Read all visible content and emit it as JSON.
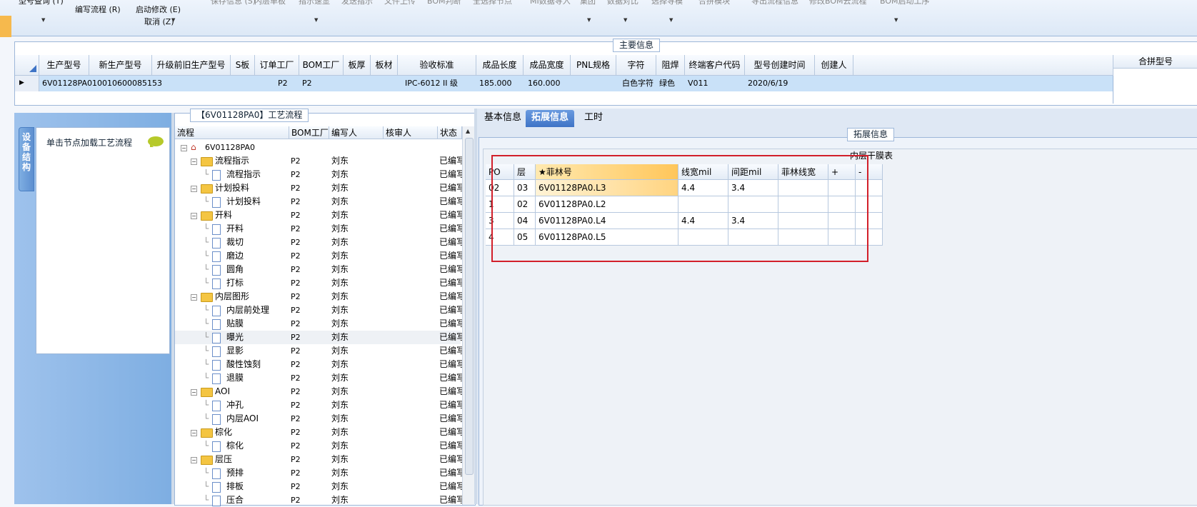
{
  "ribbon": {
    "top_row": [
      "型号查询 (T)",
      "保存信息 (S)",
      "内层单板",
      "指示速显",
      "发送指示",
      "文件上传",
      "BOM判断",
      "全选择节点",
      "MI数据导入",
      "集团",
      "数据对比",
      "选择导模",
      "合拼模块",
      "导出流程信息",
      "修改BOM云流程",
      "BOM启动工序"
    ],
    "edit_flow": "编写流程 (R)",
    "start_modify": "启动修改 (E)",
    "cancel": "取消 (Z)"
  },
  "main_info": {
    "title": "主要信息",
    "merge_header": "合拼型号",
    "columns": [
      "生产型号",
      "新生产型号",
      "升级前旧生产型号",
      "S板",
      "订单工厂",
      "BOM工厂",
      "板厚",
      "板材",
      "验收标准",
      "成品长度",
      "成品宽度",
      "PNL规格",
      "字符",
      "阻焊",
      "终端客户代码",
      "型号创建时间",
      "创建人"
    ],
    "row": [
      "6V01128PA0",
      "10010600085153",
      "",
      "",
      "P2",
      "P2",
      "",
      "",
      "IPC-6012 II 级",
      "185.000",
      "160.000",
      "",
      "白色字符",
      "绿色",
      "V011",
      "2020/6/19",
      ""
    ]
  },
  "left_panel": {
    "vertical_tab": "设备结构",
    "hint": "单击节点加载工艺流程"
  },
  "flow_tree": {
    "title": "【6V01128PA0】工艺流程",
    "columns": [
      "流程",
      "BOM工厂",
      "编写人",
      "核审人",
      "状态"
    ],
    "root": "6V01128PA0",
    "rows": [
      {
        "name": "流程指示",
        "level": 1,
        "type": "folder",
        "bom": "P2",
        "writer": "刘东",
        "status": "已编写"
      },
      {
        "name": "流程指示",
        "level": 2,
        "type": "doc",
        "bom": "P2",
        "writer": "刘东",
        "status": "已编写"
      },
      {
        "name": "计划投料",
        "level": 1,
        "type": "folder",
        "bom": "P2",
        "writer": "刘东",
        "status": "已编写"
      },
      {
        "name": "计划投料",
        "level": 2,
        "type": "doc",
        "bom": "P2",
        "writer": "刘东",
        "status": "已编写"
      },
      {
        "name": "开料",
        "level": 1,
        "type": "folder",
        "bom": "P2",
        "writer": "刘东",
        "status": "已编写"
      },
      {
        "name": "开料",
        "level": 2,
        "type": "doc",
        "bom": "P2",
        "writer": "刘东",
        "status": "已编写"
      },
      {
        "name": "裁切",
        "level": 2,
        "type": "doc",
        "bom": "P2",
        "writer": "刘东",
        "status": "已编写"
      },
      {
        "name": "磨边",
        "level": 2,
        "type": "doc",
        "bom": "P2",
        "writer": "刘东",
        "status": "已编写"
      },
      {
        "name": "圆角",
        "level": 2,
        "type": "doc",
        "bom": "P2",
        "writer": "刘东",
        "status": "已编写"
      },
      {
        "name": "打标",
        "level": 2,
        "type": "doc",
        "bom": "P2",
        "writer": "刘东",
        "status": "已编写"
      },
      {
        "name": "内层图形",
        "level": 1,
        "type": "folder",
        "bom": "P2",
        "writer": "刘东",
        "status": "已编写"
      },
      {
        "name": "内层前处理",
        "level": 2,
        "type": "doc",
        "bom": "P2",
        "writer": "刘东",
        "status": "已编写"
      },
      {
        "name": "贴膜",
        "level": 2,
        "type": "doc",
        "bom": "P2",
        "writer": "刘东",
        "status": "已编写"
      },
      {
        "name": "曝光",
        "level": 2,
        "type": "doc",
        "bom": "P2",
        "writer": "刘东",
        "status": "已编写",
        "selected": true
      },
      {
        "name": "显影",
        "level": 2,
        "type": "doc",
        "bom": "P2",
        "writer": "刘东",
        "status": "已编写"
      },
      {
        "name": "酸性蚀刻",
        "level": 2,
        "type": "doc",
        "bom": "P2",
        "writer": "刘东",
        "status": "已编写"
      },
      {
        "name": "退膜",
        "level": 2,
        "type": "doc",
        "bom": "P2",
        "writer": "刘东",
        "status": "已编写"
      },
      {
        "name": "AOI",
        "level": 1,
        "type": "folder",
        "bom": "P2",
        "writer": "刘东",
        "status": "已编写"
      },
      {
        "name": "冲孔",
        "level": 2,
        "type": "doc",
        "bom": "P2",
        "writer": "刘东",
        "status": "已编写"
      },
      {
        "name": "内层AOI",
        "level": 2,
        "type": "doc",
        "bom": "P2",
        "writer": "刘东",
        "status": "已编写"
      },
      {
        "name": "棕化",
        "level": 1,
        "type": "folder",
        "bom": "P2",
        "writer": "刘东",
        "status": "已编写"
      },
      {
        "name": "棕化",
        "level": 2,
        "type": "doc",
        "bom": "P2",
        "writer": "刘东",
        "status": "已编写"
      },
      {
        "name": "层压",
        "level": 1,
        "type": "folder",
        "bom": "P2",
        "writer": "刘东",
        "status": "已编写"
      },
      {
        "name": "预排",
        "level": 2,
        "type": "doc",
        "bom": "P2",
        "writer": "刘东",
        "status": "已编写"
      },
      {
        "name": "排板",
        "level": 2,
        "type": "doc",
        "bom": "P2",
        "writer": "刘东",
        "status": "已编写"
      },
      {
        "name": "压合",
        "level": 2,
        "type": "doc",
        "bom": "P2",
        "writer": "刘东",
        "status": "已编写"
      }
    ]
  },
  "right_tabs": [
    {
      "label": "基本信息",
      "active": false
    },
    {
      "label": "拓展信息",
      "active": true
    },
    {
      "label": "工时",
      "active": false
    }
  ],
  "ext_info": {
    "title": "拓展信息",
    "layer_table_title": "内层干膜表",
    "columns": [
      "PO",
      "层",
      "★菲林号",
      "线宽mil",
      "间距mil",
      "菲林线宽",
      "+",
      "-"
    ],
    "rows": [
      [
        "02",
        "03",
        "6V01128PA0.L3",
        "4.4",
        "3.4",
        "",
        "",
        ""
      ],
      [
        "1",
        "02",
        "6V01128PA0.L2",
        "",
        "",
        "",
        "",
        ""
      ],
      [
        "3",
        "04",
        "6V01128PA0.L4",
        "4.4",
        "3.4",
        "",
        "",
        ""
      ],
      [
        "4",
        "05",
        "6V01128PA0.L5",
        "",
        "",
        "",
        "",
        ""
      ]
    ]
  },
  "colors": {
    "accent": "#3f74c6",
    "selection": "#c9e1f8",
    "highlight_box": "#d21f2a",
    "folder": "#f4c542"
  }
}
